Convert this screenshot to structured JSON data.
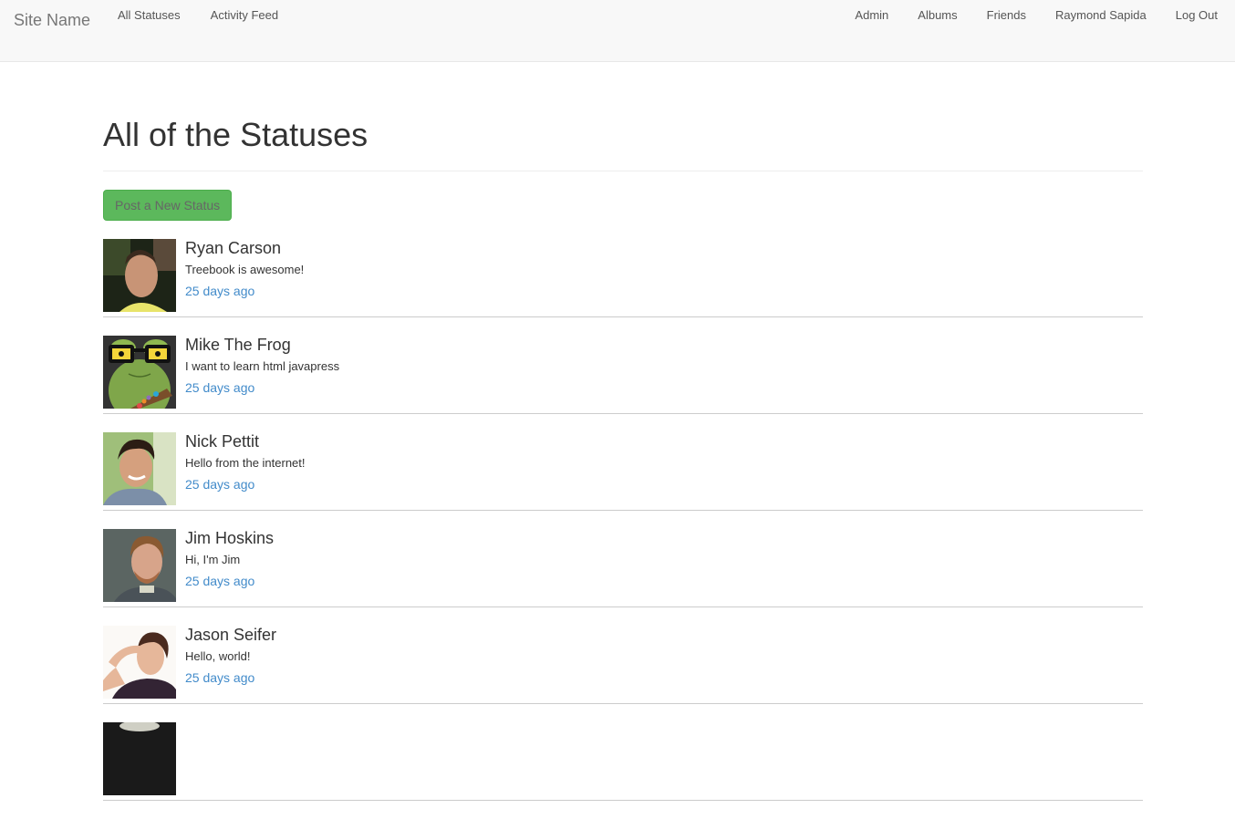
{
  "navbar": {
    "brand": "Site Name",
    "left_links": [
      {
        "label": "All Statuses"
      },
      {
        "label": "Activity Feed"
      }
    ],
    "right_links": [
      {
        "label": "Admin"
      },
      {
        "label": "Albums"
      },
      {
        "label": "Friends"
      },
      {
        "label": "Raymond Sapida"
      },
      {
        "label": "Log Out"
      }
    ]
  },
  "page": {
    "title": "All of the Statuses",
    "post_button": "Post a New Status"
  },
  "statuses": [
    {
      "name": "Ryan Carson",
      "text": "Treebook is awesome!",
      "time": "25 days ago",
      "avatar": "ryan-carson-photo"
    },
    {
      "name": "Mike The Frog",
      "text": "I want to learn html javapress",
      "time": "25 days ago",
      "avatar": "mike-the-frog-illustration"
    },
    {
      "name": "Nick Pettit",
      "text": "Hello from the internet!",
      "time": "25 days ago",
      "avatar": "nick-pettit-photo"
    },
    {
      "name": "Jim Hoskins",
      "text": "Hi, I'm Jim",
      "time": "25 days ago",
      "avatar": "jim-hoskins-photo"
    },
    {
      "name": "Jason Seifer",
      "text": "Hello, world!",
      "time": "25 days ago",
      "avatar": "jason-seifer-photo"
    },
    {
      "name": "",
      "text": "",
      "time": "",
      "avatar": "partially-visible-photo"
    }
  ],
  "colors": {
    "navbar_bg": "#f8f8f8",
    "button_green": "#5cb85c",
    "link_blue": "#428bca"
  }
}
